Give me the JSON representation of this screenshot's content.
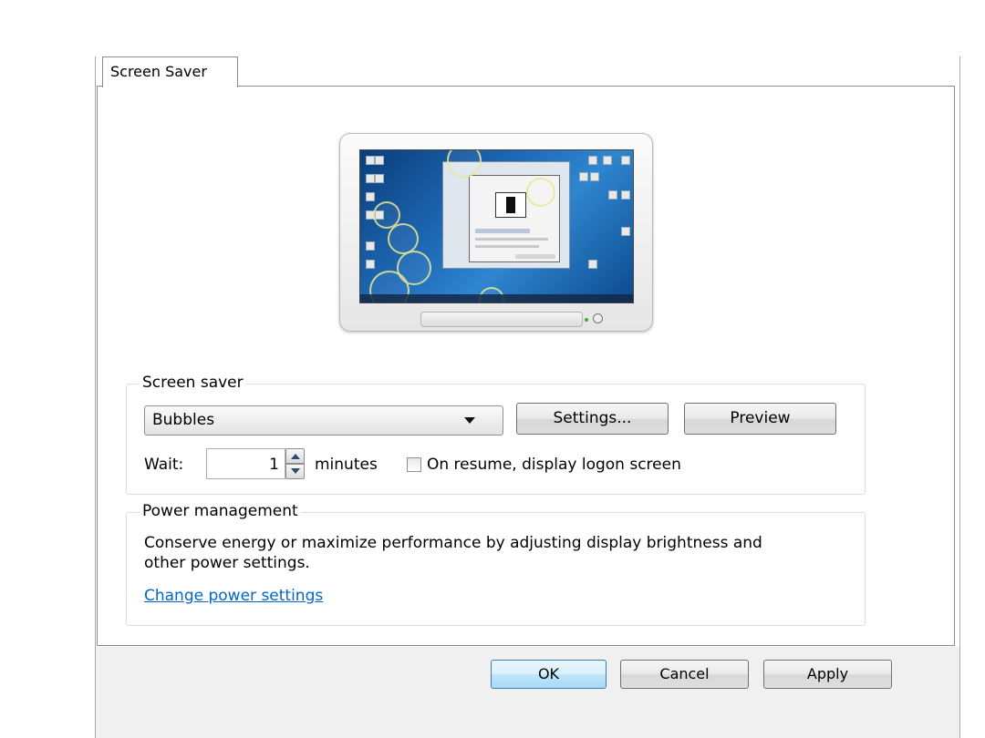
{
  "tabs": [
    {
      "label": "Screen Saver"
    }
  ],
  "screen_saver": {
    "legend": "Screen saver",
    "selected": "Bubbles",
    "settings_label": "Settings...",
    "preview_label": "Preview",
    "wait_label": "Wait:",
    "wait_value": "1",
    "minutes_label": "minutes",
    "resume_label": "On resume, display logon screen",
    "resume_checked": false
  },
  "power_management": {
    "legend": "Power management",
    "description": "Conserve energy or maximize performance by adjusting display brightness and other power settings.",
    "link": "Change power settings"
  },
  "buttons": {
    "ok": "OK",
    "cancel": "Cancel",
    "apply": "Apply"
  },
  "colors": {
    "link": "#0066cc",
    "ok_border": "#3c7fb1",
    "group_border": "#d5dfe5"
  },
  "icons": {
    "monitor": "monitor-preview-icon",
    "dropdown": "chevron-down-icon",
    "spin_up": "spin-up-icon",
    "spin_down": "spin-down-icon"
  }
}
